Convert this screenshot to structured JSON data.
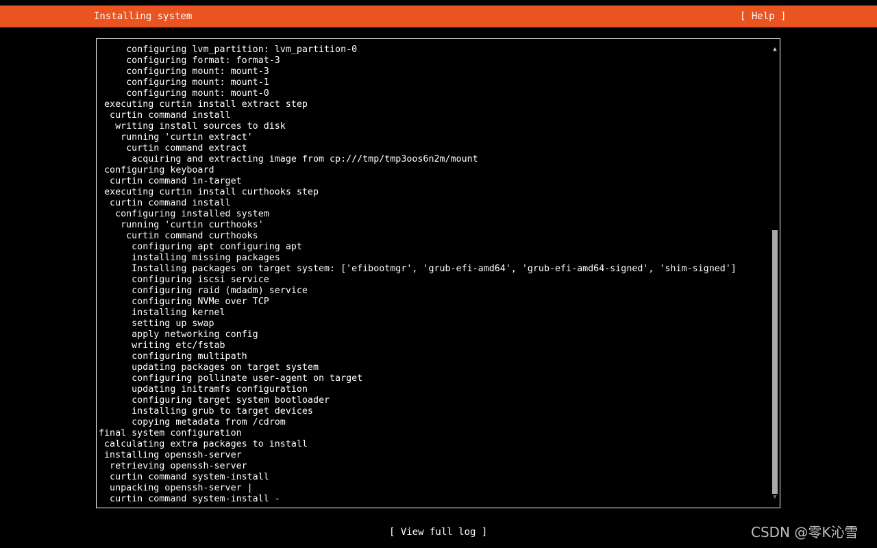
{
  "header": {
    "title": "Installing system",
    "help_label": "[ Help ]",
    "background_color": "#e95420"
  },
  "log": {
    "lines": [
      "     configuring lvm_partition: lvm_partition-0",
      "     configuring format: format-3",
      "     configuring mount: mount-3",
      "     configuring mount: mount-1",
      "     configuring mount: mount-0",
      " executing curtin install extract step",
      "  curtin command install",
      "   writing install sources to disk",
      "    running 'curtin extract'",
      "     curtin command extract",
      "      acquiring and extracting image from cp:///tmp/tmp3oos6n2m/mount",
      " configuring keyboard",
      "  curtin command in-target",
      " executing curtin install curthooks step",
      "  curtin command install",
      "   configuring installed system",
      "    running 'curtin curthooks'",
      "     curtin command curthooks",
      "      configuring apt configuring apt",
      "      installing missing packages",
      "      Installing packages on target system: ['efibootmgr', 'grub-efi-amd64', 'grub-efi-amd64-signed', 'shim-signed']",
      "      configuring iscsi service",
      "      configuring raid (mdadm) service",
      "      configuring NVMe over TCP",
      "      installing kernel",
      "      setting up swap",
      "      apply networking config",
      "      writing etc/fstab",
      "      configuring multipath",
      "      updating packages on target system",
      "      configuring pollinate user-agent on target",
      "      updating initramfs configuration",
      "      configuring target system bootloader",
      "      installing grub to target devices",
      "      copying metadata from /cdrom",
      "final system configuration",
      " calculating extra packages to install",
      " installing openssh-server",
      "  retrieving openssh-server",
      "  curtin command system-install",
      "  unpacking openssh-server |",
      "  curtin command system-install -"
    ]
  },
  "scrollbar": {
    "up_glyph": "▲",
    "down_glyph": "▼",
    "scroll_position": 0.6,
    "visible_fraction": 0.6
  },
  "footer": {
    "view_log_label": "[ View full log ]"
  },
  "watermark": {
    "text": "CSDN @零K沁雪"
  }
}
